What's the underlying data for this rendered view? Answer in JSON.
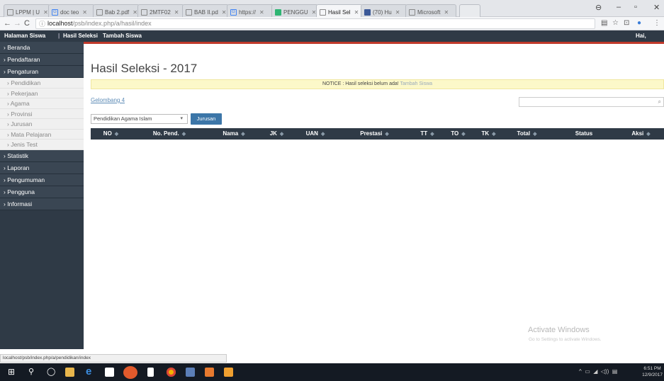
{
  "browser": {
    "tabs": [
      {
        "title": "LPPM | U",
        "icon": "page-icon"
      },
      {
        "title": "doc teo",
        "icon": "google-icon"
      },
      {
        "title": "Bab 2.pdf",
        "icon": "page-icon"
      },
      {
        "title": "2MTF02",
        "icon": "page-icon"
      },
      {
        "title": "BAB II.pd",
        "icon": "page-icon"
      },
      {
        "title": "https://",
        "icon": "google-icon"
      },
      {
        "title": "PENGGU",
        "icon": "green-doc-icon"
      },
      {
        "title": "Hasil Sel",
        "icon": "page-icon"
      },
      {
        "title": "(70) Hu",
        "icon": "facebook-icon"
      },
      {
        "title": "Microsoft",
        "icon": "page-icon"
      }
    ],
    "url_host": "localhost",
    "url_path": "/psb/index.php/a/hasil/index",
    "status_url": "localhost/psb/index.php/a/pendidikan/index"
  },
  "topnav": {
    "home": "Halaman Siswa",
    "hasil": "Hasil Seleksi",
    "tambah": "Tambah Siswa",
    "greeting": "Hai, admin"
  },
  "sidebar": {
    "items": [
      {
        "label": "Beranda"
      },
      {
        "label": "Pendaftaran"
      },
      {
        "label": "Pengaturan"
      }
    ],
    "subitems": [
      {
        "label": "Pendidikan"
      },
      {
        "label": "Pekerjaan"
      },
      {
        "label": "Agama"
      },
      {
        "label": "Provinsi"
      },
      {
        "label": "Jurusan"
      },
      {
        "label": "Mata Pelajaran"
      },
      {
        "label": "Jenis Test"
      }
    ],
    "items_after": [
      {
        "label": "Statistik"
      },
      {
        "label": "Laporan"
      },
      {
        "label": "Pengumuman"
      },
      {
        "label": "Pengguna"
      },
      {
        "label": "Informasi"
      }
    ]
  },
  "main": {
    "title": "Hasil Seleksi - 2017",
    "notice_text": "NOTICE : Hasil seleksi belum ada!",
    "notice_link": "Tambah Siswa",
    "gelombang": "Gelombang 4",
    "filter_value": "Pendidikan Agama Islam",
    "jurusan_button": "Jurusan",
    "columns": [
      "NO",
      "No. Pend.",
      "Nama",
      "JK",
      "UAN",
      "Prestasi",
      "TT",
      "TO",
      "TK",
      "Total",
      "Status",
      "Aksi"
    ]
  },
  "os": {
    "watermark_title": "Activate Windows",
    "watermark_sub": "Go to Settings to activate Windows.",
    "time": "6:51 PM",
    "date": "12/9/2017"
  }
}
